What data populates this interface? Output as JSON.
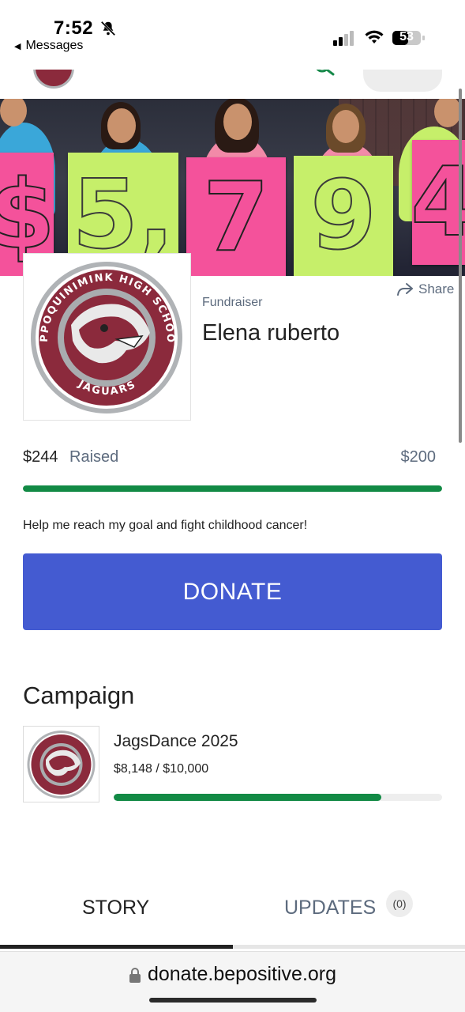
{
  "status_bar": {
    "time": "7:52",
    "back_label": "Messages",
    "battery": "53"
  },
  "banner": {
    "signs": [
      "$",
      "5,",
      "7",
      "9",
      "4"
    ]
  },
  "profile": {
    "role": "Fundraiser",
    "name": "Elena ruberto",
    "share_label": "Share",
    "logo_text_top": "APPOQUINIMINK HIGH SCHOOL",
    "logo_text_bottom": "JAGUARS"
  },
  "fundraising": {
    "raised_amount": "$244",
    "raised_label": "Raised",
    "goal_amount": "$200",
    "progress": 1.0,
    "tagline": "Help me reach my goal and fight childhood cancer!",
    "donate_label": "DONATE"
  },
  "campaign": {
    "heading": "Campaign",
    "name": "JagsDance 2025",
    "amount_text": "$8,148 / $10,000",
    "progress": 0.8148
  },
  "tabs": [
    {
      "label": "STORY",
      "active": true
    },
    {
      "label": "UPDATES",
      "badge": "(0)",
      "active": false
    }
  ],
  "browser": {
    "url": "donate.bepositive.org"
  },
  "colors": {
    "brand_green": "#128a45",
    "donate_blue": "#445bd1",
    "school_maroon": "#8b2a3c"
  }
}
